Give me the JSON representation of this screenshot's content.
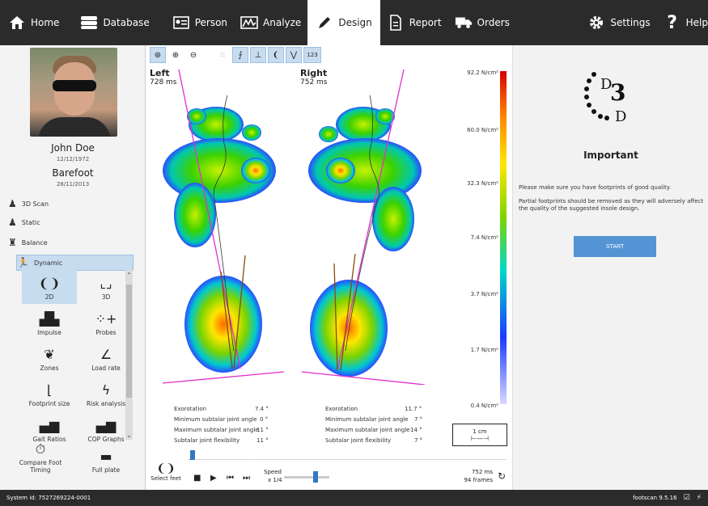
{
  "nav": {
    "home": "Home",
    "database": "Database",
    "person": "Person",
    "analyze": "Analyze",
    "design": "Design",
    "report": "Report",
    "orders": "Orders",
    "settings": "Settings",
    "help": "Help"
  },
  "patient": {
    "name": "John Doe",
    "dob": "12/12/1972",
    "condition": "Barefoot",
    "date": "28/11/2013"
  },
  "sidebar": {
    "items": [
      {
        "label": "3D Scan",
        "icon": "scan-icon"
      },
      {
        "label": "Static",
        "icon": "static-icon"
      },
      {
        "label": "Balance",
        "icon": "balance-icon"
      },
      {
        "label": "Dynamic",
        "icon": "dynamic-icon"
      }
    ],
    "tools": [
      {
        "label": "2D",
        "icon": "footprints-2d-icon"
      },
      {
        "label": "3D",
        "icon": "footprint-3d-icon"
      },
      {
        "label": "Impulse",
        "icon": "impulse-icon"
      },
      {
        "label": "Probes",
        "icon": "probes-icon"
      },
      {
        "label": "Zones",
        "icon": "zones-icon"
      },
      {
        "label": "Load rate",
        "icon": "load-rate-icon"
      },
      {
        "label": "Footprint size",
        "icon": "footprint-size-icon"
      },
      {
        "label": "Risk analysis",
        "icon": "risk-analysis-icon"
      },
      {
        "label": "Gait Ratios",
        "icon": "gait-ratios-icon"
      },
      {
        "label": "COP Graphs",
        "icon": "cop-graphs-icon"
      },
      {
        "label": "Compare Foot Timing",
        "icon": "compare-timing-icon"
      },
      {
        "label": "Full plate",
        "icon": "full-plate-icon"
      }
    ]
  },
  "view": {
    "left_title": "Left",
    "left_time": "728 ms",
    "right_title": "Right",
    "right_time": "752 ms",
    "toolbar_badge": "123"
  },
  "colorbar": {
    "labels": [
      "92.2 N/cm²",
      "60.0 N/cm²",
      "32.3 N/cm²",
      "7.4 N/cm²",
      "3.7 N/cm²",
      "1.7 N/cm²",
      "0.4 N/cm²"
    ],
    "colors": [
      "#d60000",
      "#ff8a00",
      "#ffe600",
      "#7cd400",
      "#00c8d0",
      "#1a3aff",
      "#d8d8ff"
    ]
  },
  "metrics": {
    "left": [
      {
        "label": "Exorotation",
        "value": "7.4 °"
      },
      {
        "label": "Minimum subtalar joint angle",
        "value": "0 °"
      },
      {
        "label": "Maximum subtalar joint angle",
        "value": "11 °"
      },
      {
        "label": "Subtalar joint flexibility",
        "value": "11 °"
      }
    ],
    "right": [
      {
        "label": "Exorotation",
        "value": "11.7 °"
      },
      {
        "label": "Minimum subtalar joint angle",
        "value": "7 °"
      },
      {
        "label": "Maximum subtalar joint angle",
        "value": "14 °"
      },
      {
        "label": "Subtalar joint flexibility",
        "value": "7 °"
      }
    ]
  },
  "scale": {
    "label": "1 cm"
  },
  "player": {
    "select_feet": "Select feet",
    "speed_label": "Speed",
    "speed_value": "x 1/4",
    "time": "752 ms",
    "frames": "94 frames"
  },
  "right_panel": {
    "logo_text": "D3D",
    "heading": "Important",
    "p1": "Please make sure you have footprints of good quality.",
    "p2": "Partial footprints should be removed as they will adversely affect the quality of the suggested insole design.",
    "start": "START"
  },
  "status": {
    "system_id": "System id: 7527269224-0001",
    "version": "footscan 9.5.16"
  }
}
